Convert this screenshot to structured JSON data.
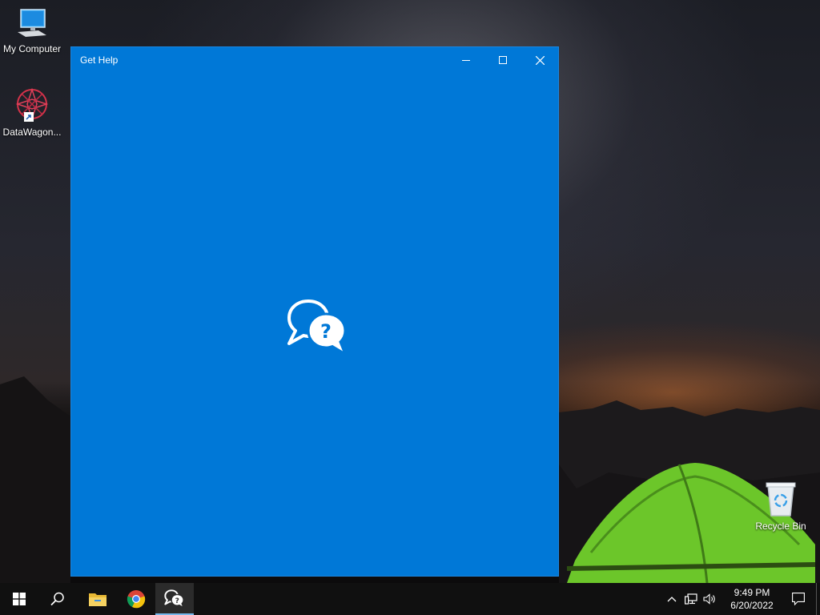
{
  "desktop": {
    "icons": [
      {
        "label": "My Computer",
        "icon": "computer-icon"
      },
      {
        "label": "DataWagon...",
        "icon": "datawagon-icon"
      },
      {
        "label": "Recycle Bin",
        "icon": "recycle-bin-icon"
      }
    ]
  },
  "window": {
    "title": "Get Help",
    "controls": [
      "minimize-icon",
      "maximize-icon",
      "close-icon"
    ],
    "splash_icon": "get-help-icon",
    "background": "#0078d7"
  },
  "taskbar": {
    "items": [
      "start-icon",
      "search-icon",
      "file-explorer-icon",
      "chrome-icon",
      "get-help-icon"
    ],
    "active_item": "get-help-icon",
    "tray": {
      "icons": [
        "chevron-up-icon",
        "network-icon",
        "volume-icon"
      ],
      "time": "9:49 PM",
      "date": "6/20/2022",
      "notification_icon": "action-center-icon"
    }
  }
}
